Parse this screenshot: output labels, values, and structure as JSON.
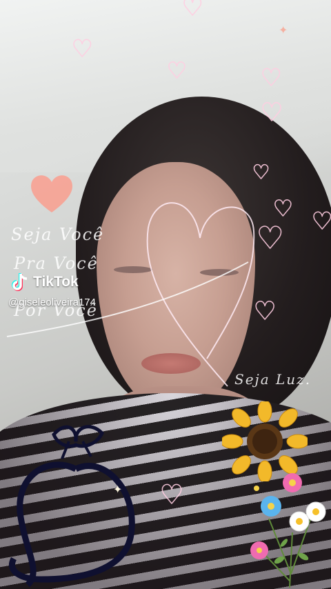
{
  "overlay": {
    "brand": "TikTok",
    "handle": "@giseleoliveira174",
    "text_lines": [
      "Seja Você",
      "Pra Você",
      "Por Você"
    ],
    "caption": "Seja Luz."
  },
  "icons": [
    "tiktok-logo-icon",
    "heart-icon",
    "sunflower-icon",
    "daisy-icon"
  ],
  "colors": {
    "tiktok_cyan": "#25f4ee",
    "tiktok_red": "#fe2c55",
    "heart_outline": "#ffcde1",
    "sunflower": "#f2b92a"
  }
}
